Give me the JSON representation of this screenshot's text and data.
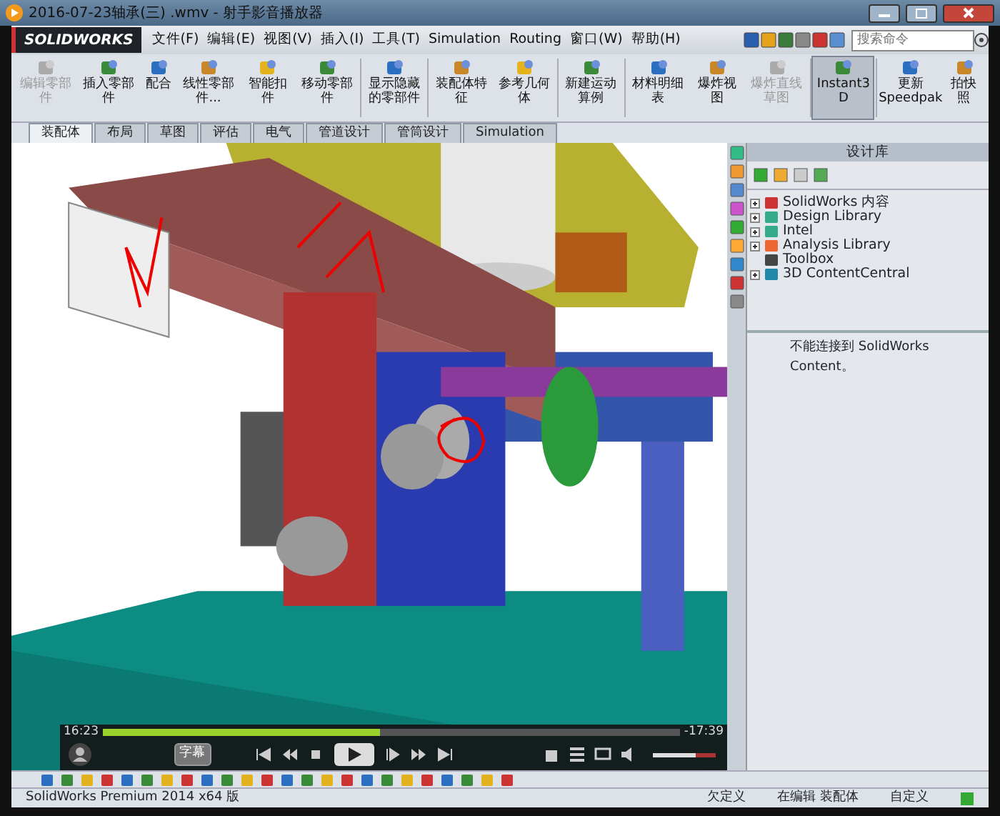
{
  "window": {
    "title": "2016-07-23轴承(三) .wmv - 射手影音播放器"
  },
  "solidworks": {
    "logo": "SOLIDWORKS",
    "menus": [
      "文件(F)",
      "编辑(E)",
      "视图(V)",
      "插入(I)",
      "工具(T)",
      "Simulation",
      "Routing",
      "窗口(W)",
      "帮助(H)"
    ],
    "search": {
      "placeholder": "搜索命令"
    },
    "commands": [
      {
        "label": "编辑零部件",
        "disabled": true,
        "selected": false
      },
      {
        "label": "插入零部件",
        "disabled": false,
        "selected": false
      },
      {
        "label": "配合",
        "disabled": false,
        "selected": false
      },
      {
        "label": "线性零部件...",
        "disabled": false,
        "selected": false
      },
      {
        "label": "智能扣件",
        "disabled": false,
        "selected": false
      },
      {
        "label": "移动零部件",
        "disabled": false,
        "selected": false
      },
      {
        "label": "显示隐藏的零部件",
        "disabled": false,
        "selected": false
      },
      {
        "label": "装配体特征",
        "disabled": false,
        "selected": false
      },
      {
        "label": "参考几何体",
        "disabled": false,
        "selected": false
      },
      {
        "label": "新建运动算例",
        "disabled": false,
        "selected": false
      },
      {
        "label": "材料明细表",
        "disabled": false,
        "selected": false
      },
      {
        "label": "爆炸视图",
        "disabled": false,
        "selected": false
      },
      {
        "label": "爆炸直线草图",
        "disabled": true,
        "selected": false
      },
      {
        "label": "Instant3D",
        "disabled": false,
        "selected": true
      },
      {
        "label": "更新 Speedpak",
        "disabled": false,
        "selected": false
      },
      {
        "label": "拍快照",
        "disabled": false,
        "selected": false
      }
    ],
    "tabs": [
      {
        "label": "装配体",
        "selected": true
      },
      {
        "label": "布局",
        "selected": false
      },
      {
        "label": "草图",
        "selected": false
      },
      {
        "label": "评估",
        "selected": false
      },
      {
        "label": "电气",
        "selected": false
      },
      {
        "label": "管道设计",
        "selected": false
      },
      {
        "label": "管筒设计",
        "selected": false
      },
      {
        "label": "Simulation",
        "selected": false
      }
    ],
    "design_library": {
      "title": "设计库",
      "items": [
        {
          "label": "SolidWorks 内容",
          "expandable": true
        },
        {
          "label": "Design Library",
          "expandable": true
        },
        {
          "label": "Intel",
          "expandable": true
        },
        {
          "label": "Analysis Library",
          "expandable": true
        },
        {
          "label": "Toolbox",
          "expandable": false
        },
        {
          "label": "3D ContentCentral",
          "expandable": true
        }
      ],
      "message": "不能连接到 SolidWorks Content。"
    },
    "status_bar": {
      "product": "SolidWorks Premium 2014 x64 版",
      "items": [
        "欠定义",
        "在编辑 装配体",
        "自定义"
      ]
    }
  },
  "player": {
    "elapsed": "16:23",
    "remaining": "-17:39",
    "progress": {
      "level": 0.48
    },
    "subtitle_button": "字幕",
    "volume": {
      "level": 0.68
    }
  }
}
